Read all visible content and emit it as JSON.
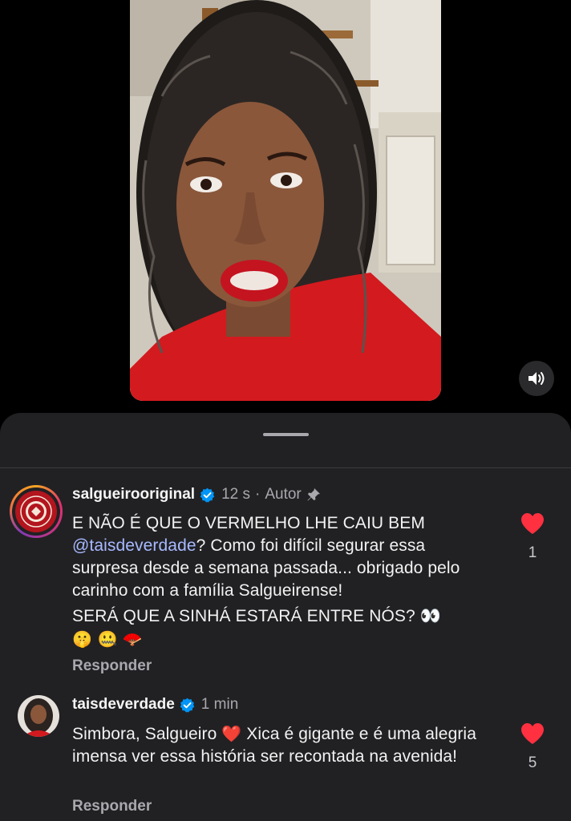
{
  "colors": {
    "sheet_bg": "#212124",
    "like_red": "#ff3040",
    "verified_blue": "#0095f6",
    "mention": "#a8b9ff",
    "muted_text": "#a8a8ad"
  },
  "video": {
    "mute_icon": "speaker-icon"
  },
  "comments": [
    {
      "username": "salgueirooriginal",
      "verified": true,
      "time": "12 s",
      "author_label": "Autor",
      "pinned": true,
      "text_line1": "E NÃO É QUE O VERMELHO LHE CAIU BEM",
      "mention": "@taisdeverdade",
      "text_rest": "? Como foi difícil segurar essa surpresa desde a semana passada... obrigado pelo carinho com a família Salgueirense!",
      "text_p2": "SERÁ QUE A SINHÁ ESTARÁ ENTRE NÓS? 👀",
      "emojis": "🤫 🤐 🪭",
      "reply_label": "Responder",
      "like_count": "1",
      "liked": true
    },
    {
      "username": "taisdeverdade",
      "verified": true,
      "time": "1 min",
      "text_a": "Simbora, Salgueiro",
      "heart": "❤️",
      "text_b": "Xica é gigante e é uma alegria imensa ver essa história ser recontada na avenida!",
      "reply_label": "Responder",
      "like_count": "5",
      "liked": true
    }
  ]
}
